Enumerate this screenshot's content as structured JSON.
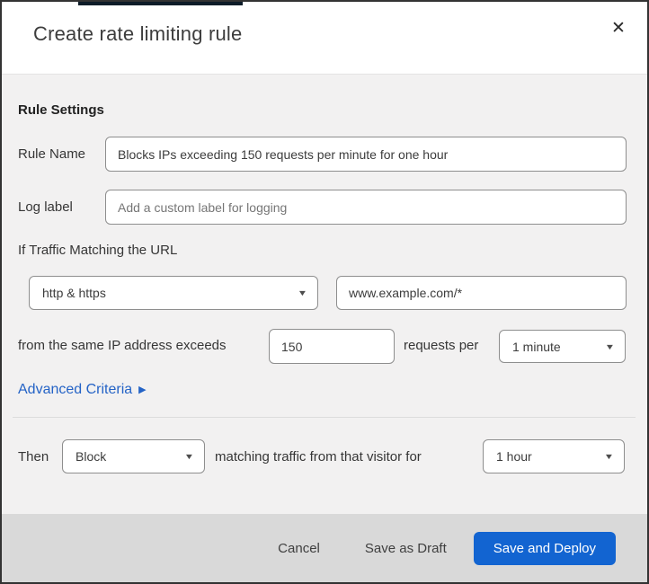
{
  "dialog": {
    "title": "Create rate limiting rule"
  },
  "icons": {
    "close-icon": "✕",
    "chevron-down-icon": "▼",
    "arrow-right-icon": "▶"
  },
  "rule_settings": {
    "heading": "Rule Settings",
    "rule_name": {
      "label": "Rule Name",
      "value": "Blocks IPs exceeding 150 requests per minute for one hour"
    },
    "log_label": {
      "label": "Log label",
      "placeholder": "Add a custom label for logging"
    }
  },
  "match": {
    "intro": "If Traffic Matching the URL",
    "scheme_selected": "http & https",
    "url_value": "www.example.com/*",
    "threshold_prefix": "from the same IP address exceeds",
    "request_count": "150",
    "threshold_middle": "requests per",
    "period_selected": "1 minute",
    "advanced_link": "Advanced Criteria"
  },
  "action": {
    "then_label": "Then",
    "action_selected": "Block",
    "middle_text": "matching traffic from that visitor for",
    "duration_selected": "1 hour"
  },
  "footer": {
    "cancel": "Cancel",
    "save_draft": "Save as Draft",
    "save_deploy": "Save and Deploy"
  },
  "colors": {
    "link_blue": "#2463c6",
    "primary_button_blue": "#1264d1",
    "footer_gray": "#d9d9d9",
    "body_gray": "#f2f1f1",
    "top_strip_navy": "#0d1c29"
  }
}
